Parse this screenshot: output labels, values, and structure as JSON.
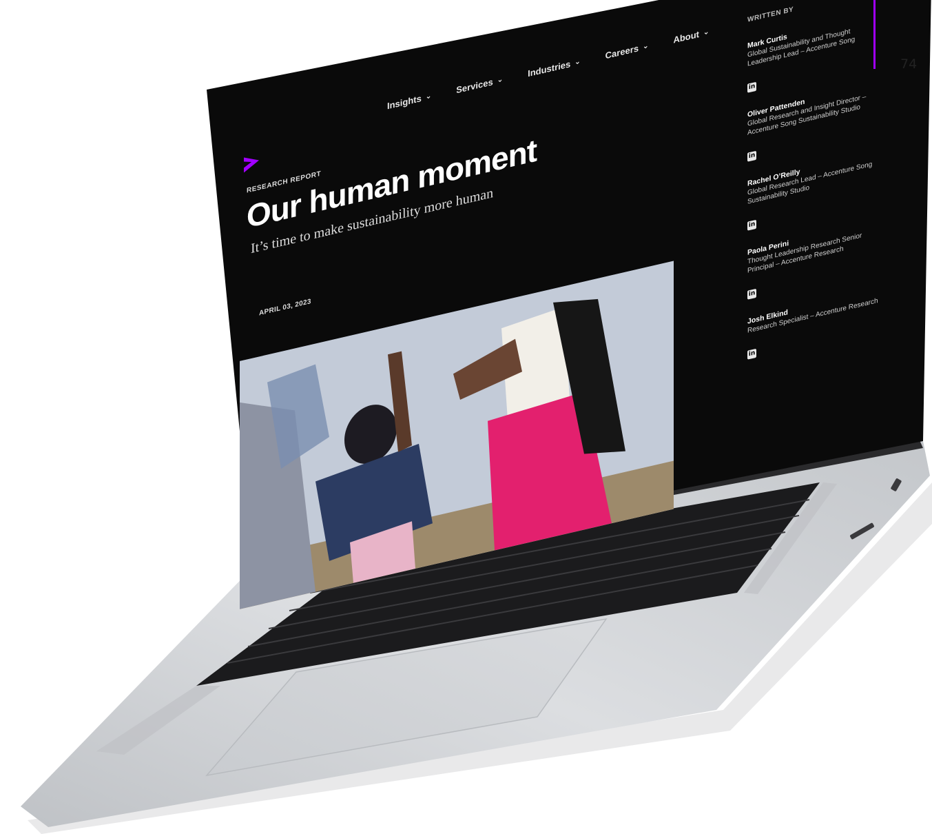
{
  "page_number": "74",
  "nav": {
    "items": [
      {
        "label": "Insights"
      },
      {
        "label": "Services"
      },
      {
        "label": "Industries"
      },
      {
        "label": "Careers"
      },
      {
        "label": "About"
      }
    ]
  },
  "article": {
    "kicker": "RESEARCH REPORT",
    "title": "Our human moment",
    "subtitle": "It’s time to make sustainability more human",
    "date": "APRIL 03, 2023"
  },
  "sidebar": {
    "heading": "WRITTEN BY",
    "authors": [
      {
        "name": "Mark Curtis",
        "role": "Global Sustainability and Thought Leadership Lead – Accenture Song"
      },
      {
        "name": "Oliver Pattenden",
        "role": "Global Research and Insight Director – Accenture Song Sustainability Studio"
      },
      {
        "name": "Rachel O’Reilly",
        "role": "Global Research Lead – Accenture Song Sustainability Studio"
      },
      {
        "name": "Paola Perini",
        "role": "Thought Leadership Research Senior Principal – Accenture Research"
      },
      {
        "name": "Josh Elkind",
        "role": "Research Specialist – Accenture Research"
      }
    ],
    "linkedin_label": "in"
  },
  "colors": {
    "accent": "#a100ff",
    "screen_bg": "#000000",
    "laptop_body": "#d6d8db"
  }
}
